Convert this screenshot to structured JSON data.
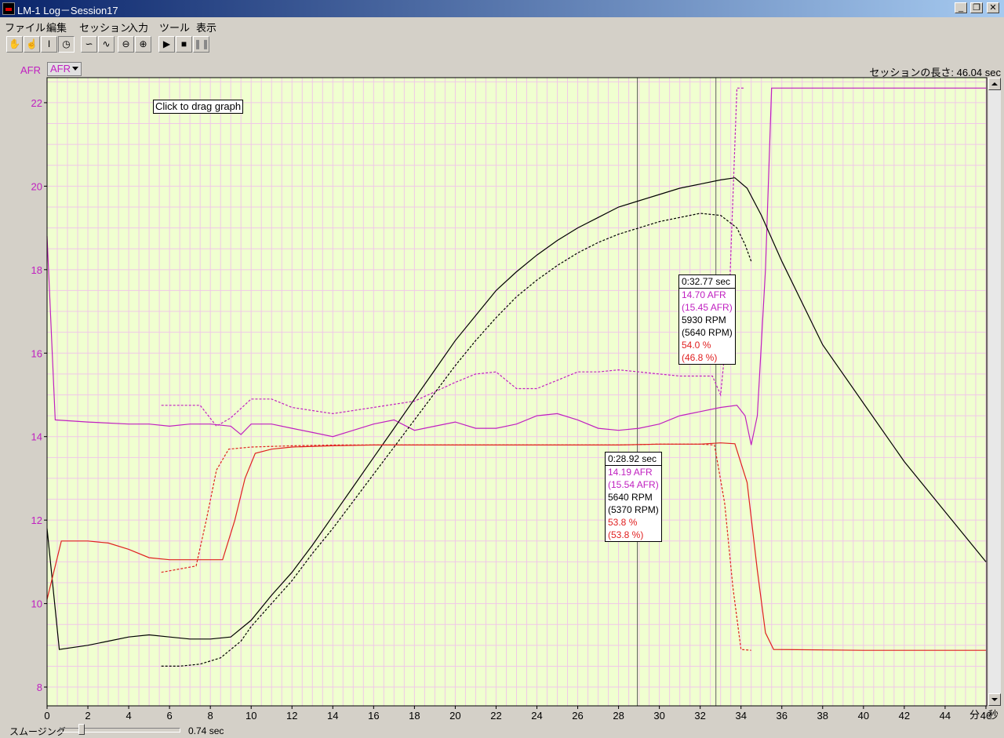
{
  "window": {
    "title": "LM-1  Log－Session17"
  },
  "menu": [
    "ファイル",
    "編集",
    "セッション",
    "入力",
    "ツール",
    "表示"
  ],
  "toolbar": {
    "icons": [
      "hand-icon",
      "hand-zoom-icon",
      "cursor-i-icon",
      "clock-icon",
      "wave-smooth-icon",
      "wave-raw-icon",
      "zoom-out-icon",
      "zoom-in-icon",
      "play-icon",
      "stop-icon",
      "pause-icon"
    ]
  },
  "axis_select": {
    "label": "AFR",
    "selected": "AFR"
  },
  "session_length": "セッションの長さ:  46.04 sec",
  "hint": "Click to drag graph",
  "unit": "分 : 秒",
  "smoothing": {
    "label": "スムージング",
    "value": "0.74 sec"
  },
  "tooltips": [
    {
      "time": "0:32.77 sec",
      "afr": "14.70 AFR",
      "afr_ref": "(15.45 AFR)",
      "rpm": "5930 RPM",
      "rpm_ref": "(5640 RPM)",
      "pct": "54.0 %",
      "pct_ref": "(46.8 %)"
    },
    {
      "time": "0:28.92 sec",
      "afr": "14.19 AFR",
      "afr_ref": "(15.54 AFR)",
      "rpm": "5640 RPM",
      "rpm_ref": "(5370 RPM)",
      "pct": "53.8 %",
      "pct_ref": "(53.8 %)"
    }
  ],
  "colors": {
    "plot_bg": "#f0ffd0",
    "grid": "#f0c8e8",
    "afr": "#c020c0",
    "rpm": "#000000",
    "pct": "#e02020",
    "axis_text": "#c020c0"
  },
  "chart_data": {
    "type": "line",
    "xlim": [
      0,
      46.04
    ],
    "ylim": [
      7.55,
      22.6
    ],
    "x_ticks": [
      0,
      2,
      4,
      6,
      8,
      10,
      12,
      14,
      16,
      18,
      20,
      22,
      24,
      26,
      28,
      30,
      32,
      34,
      36,
      38,
      40,
      42,
      44,
      46
    ],
    "y_ticks": [
      8,
      10,
      12,
      14,
      16,
      18,
      20,
      22
    ],
    "cursors": [
      28.92,
      32.77
    ],
    "series": [
      {
        "color": "afr",
        "dashed": false,
        "points": [
          [
            0,
            18.8
          ],
          [
            0.4,
            14.4
          ],
          [
            2,
            14.35
          ],
          [
            4,
            14.3
          ],
          [
            5,
            14.3
          ],
          [
            6,
            14.25
          ],
          [
            7,
            14.3
          ],
          [
            8,
            14.3
          ],
          [
            9,
            14.25
          ],
          [
            9.5,
            14.05
          ],
          [
            10,
            14.3
          ],
          [
            11,
            14.3
          ],
          [
            12,
            14.2
          ],
          [
            13,
            14.1
          ],
          [
            14,
            14.0
          ],
          [
            15,
            14.15
          ],
          [
            16,
            14.3
          ],
          [
            17,
            14.4
          ],
          [
            18,
            14.15
          ],
          [
            19,
            14.25
          ],
          [
            20,
            14.35
          ],
          [
            21,
            14.2
          ],
          [
            22,
            14.2
          ],
          [
            23,
            14.3
          ],
          [
            24,
            14.5
          ],
          [
            25,
            14.55
          ],
          [
            26,
            14.4
          ],
          [
            27,
            14.2
          ],
          [
            28,
            14.15
          ],
          [
            29,
            14.2
          ],
          [
            30,
            14.3
          ],
          [
            31,
            14.5
          ],
          [
            32,
            14.6
          ],
          [
            33,
            14.7
          ],
          [
            33.8,
            14.75
          ],
          [
            34.2,
            14.5
          ],
          [
            34.5,
            13.8
          ],
          [
            34.8,
            14.5
          ],
          [
            35.2,
            18
          ],
          [
            35.5,
            22.35
          ],
          [
            46,
            22.35
          ]
        ]
      },
      {
        "color": "afr",
        "dashed": true,
        "points": [
          [
            5.6,
            14.75
          ],
          [
            7.5,
            14.75
          ],
          [
            8.3,
            14.25
          ],
          [
            9,
            14.45
          ],
          [
            10,
            14.9
          ],
          [
            11,
            14.9
          ],
          [
            12,
            14.7
          ],
          [
            14,
            14.55
          ],
          [
            16,
            14.7
          ],
          [
            18,
            14.85
          ],
          [
            20,
            15.3
          ],
          [
            21,
            15.5
          ],
          [
            22,
            15.55
          ],
          [
            23,
            15.15
          ],
          [
            24,
            15.15
          ],
          [
            25,
            15.35
          ],
          [
            26,
            15.55
          ],
          [
            27,
            15.55
          ],
          [
            28,
            15.6
          ],
          [
            29,
            15.55
          ],
          [
            30,
            15.5
          ],
          [
            31,
            15.45
          ],
          [
            32,
            15.45
          ],
          [
            32.6,
            15.45
          ],
          [
            33,
            15.0
          ],
          [
            33.4,
            17
          ],
          [
            33.8,
            22.35
          ],
          [
            34.2,
            22.35
          ]
        ]
      },
      {
        "color": "rpm",
        "dashed": false,
        "points": [
          [
            0,
            11.8
          ],
          [
            0.6,
            8.9
          ],
          [
            2,
            9.0
          ],
          [
            3,
            9.1
          ],
          [
            4,
            9.2
          ],
          [
            5,
            9.25
          ],
          [
            6,
            9.2
          ],
          [
            7,
            9.15
          ],
          [
            8,
            9.15
          ],
          [
            9,
            9.2
          ],
          [
            10,
            9.6
          ],
          [
            11,
            10.2
          ],
          [
            12,
            10.75
          ],
          [
            13,
            11.4
          ],
          [
            14,
            12.1
          ],
          [
            15,
            12.8
          ],
          [
            16,
            13.5
          ],
          [
            17,
            14.2
          ],
          [
            18,
            14.9
          ],
          [
            19,
            15.6
          ],
          [
            20,
            16.3
          ],
          [
            21,
            16.9
          ],
          [
            22,
            17.5
          ],
          [
            23,
            17.95
          ],
          [
            24,
            18.35
          ],
          [
            25,
            18.7
          ],
          [
            26,
            19.0
          ],
          [
            27,
            19.25
          ],
          [
            28,
            19.5
          ],
          [
            29,
            19.65
          ],
          [
            30,
            19.8
          ],
          [
            31,
            19.95
          ],
          [
            32,
            20.05
          ],
          [
            33,
            20.15
          ],
          [
            33.7,
            20.2
          ],
          [
            34.3,
            19.95
          ],
          [
            35,
            19.3
          ],
          [
            36,
            18.2
          ],
          [
            38,
            16.2
          ],
          [
            40,
            14.8
          ],
          [
            42,
            13.4
          ],
          [
            44,
            12.2
          ],
          [
            46,
            11.0
          ]
        ]
      },
      {
        "color": "rpm",
        "dashed": true,
        "points": [
          [
            5.6,
            8.5
          ],
          [
            6.5,
            8.5
          ],
          [
            7.5,
            8.55
          ],
          [
            8.5,
            8.7
          ],
          [
            9.5,
            9.1
          ],
          [
            10,
            9.45
          ],
          [
            11,
            10.0
          ],
          [
            12,
            10.55
          ],
          [
            13,
            11.2
          ],
          [
            14,
            11.8
          ],
          [
            15,
            12.45
          ],
          [
            16,
            13.1
          ],
          [
            17,
            13.75
          ],
          [
            18,
            14.4
          ],
          [
            19,
            15.05
          ],
          [
            20,
            15.7
          ],
          [
            21,
            16.3
          ],
          [
            22,
            16.85
          ],
          [
            23,
            17.35
          ],
          [
            24,
            17.75
          ],
          [
            25,
            18.1
          ],
          [
            26,
            18.4
          ],
          [
            27,
            18.65
          ],
          [
            28,
            18.85
          ],
          [
            29,
            19.0
          ],
          [
            30,
            19.15
          ],
          [
            31,
            19.25
          ],
          [
            32,
            19.35
          ],
          [
            33,
            19.3
          ],
          [
            33.8,
            19.0
          ],
          [
            34.2,
            18.6
          ],
          [
            34.5,
            18.2
          ]
        ]
      },
      {
        "color": "pct",
        "dashed": false,
        "points": [
          [
            0,
            10.1
          ],
          [
            0.7,
            11.5
          ],
          [
            2,
            11.5
          ],
          [
            3,
            11.45
          ],
          [
            4,
            11.3
          ],
          [
            5,
            11.1
          ],
          [
            6,
            11.05
          ],
          [
            7,
            11.05
          ],
          [
            8,
            11.05
          ],
          [
            8.6,
            11.05
          ],
          [
            9.2,
            12.0
          ],
          [
            9.7,
            13.0
          ],
          [
            10.2,
            13.6
          ],
          [
            11,
            13.7
          ],
          [
            12,
            13.75
          ],
          [
            14,
            13.78
          ],
          [
            16,
            13.8
          ],
          [
            18,
            13.8
          ],
          [
            20,
            13.8
          ],
          [
            22,
            13.8
          ],
          [
            24,
            13.8
          ],
          [
            26,
            13.8
          ],
          [
            28,
            13.8
          ],
          [
            30,
            13.82
          ],
          [
            32,
            13.82
          ],
          [
            33,
            13.85
          ],
          [
            33.7,
            13.83
          ],
          [
            34.3,
            12.9
          ],
          [
            34.8,
            10.8
          ],
          [
            35.2,
            9.3
          ],
          [
            35.6,
            8.9
          ],
          [
            40,
            8.88
          ],
          [
            46,
            8.88
          ]
        ]
      },
      {
        "color": "pct",
        "dashed": true,
        "points": [
          [
            5.6,
            10.75
          ],
          [
            7.3,
            10.9
          ],
          [
            7.8,
            12.0
          ],
          [
            8.3,
            13.2
          ],
          [
            8.9,
            13.7
          ],
          [
            10,
            13.75
          ],
          [
            12,
            13.78
          ],
          [
            14,
            13.8
          ],
          [
            16,
            13.8
          ],
          [
            18,
            13.8
          ],
          [
            20,
            13.8
          ],
          [
            22,
            13.8
          ],
          [
            24,
            13.8
          ],
          [
            26,
            13.8
          ],
          [
            28,
            13.8
          ],
          [
            30,
            13.82
          ],
          [
            32,
            13.82
          ],
          [
            32.7,
            13.8
          ],
          [
            33.2,
            12.4
          ],
          [
            33.6,
            10.4
          ],
          [
            34,
            8.9
          ],
          [
            34.5,
            8.88
          ]
        ]
      }
    ]
  }
}
